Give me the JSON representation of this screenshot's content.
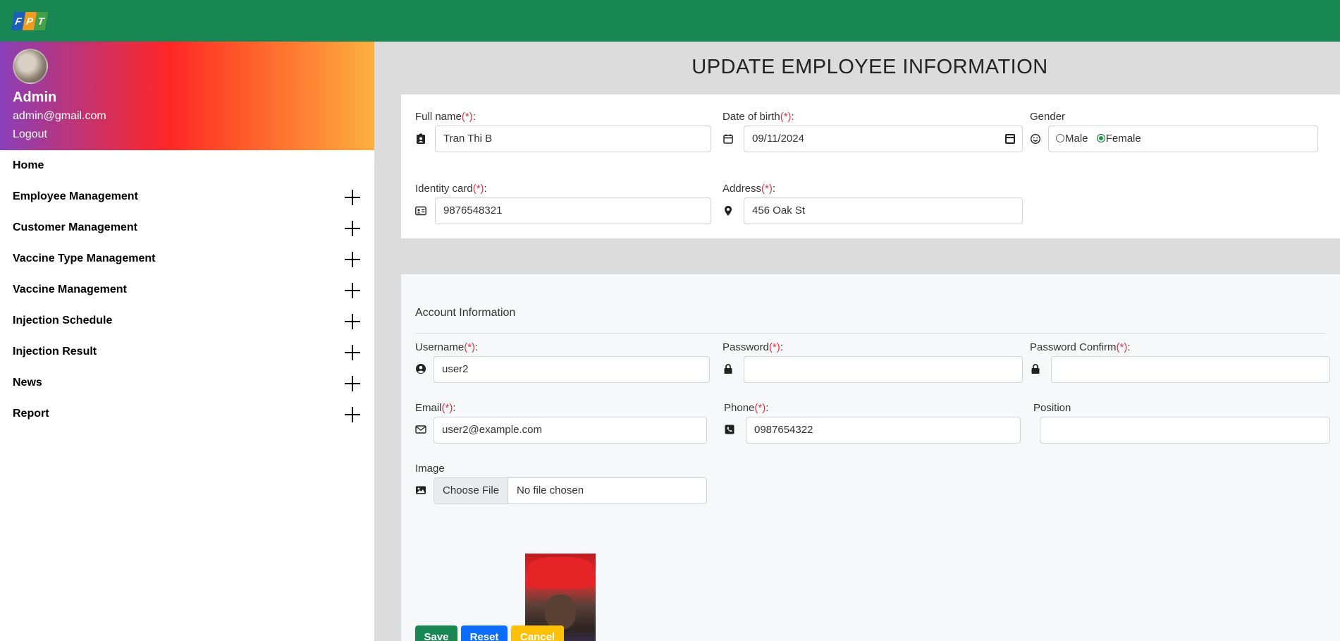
{
  "header": {
    "logo_letters": [
      "F",
      "P",
      "T"
    ],
    "logo_colors": [
      "#1c5fb8",
      "#f29a1f",
      "#43a047"
    ],
    "bar_color": "#198754"
  },
  "sidebar": {
    "user": {
      "name": "Admin",
      "email": "admin@gmail.com",
      "logout_label": "Logout"
    },
    "home_label": "Home",
    "items": [
      {
        "label": "Employee Management",
        "icon": "plus-icon"
      },
      {
        "label": "Customer Management",
        "icon": "plus-icon"
      },
      {
        "label": "Vaccine Type Management",
        "icon": "plus-icon"
      },
      {
        "label": "Vaccine Management",
        "icon": "plus-icon"
      },
      {
        "label": "Injection Schedule",
        "icon": "plus-icon"
      },
      {
        "label": "Injection Result",
        "icon": "plus-icon"
      },
      {
        "label": "News",
        "icon": "plus-icon"
      },
      {
        "label": "Report",
        "icon": "plus-icon"
      }
    ]
  },
  "main": {
    "title": "UPDATE EMPLOYEE INFORMATION",
    "required_mark": "(*)",
    "colon": ":",
    "personal": {
      "full_name": {
        "label": "Full name",
        "value": "Tran Thi B",
        "icon": "id-badge-icon"
      },
      "date_of_birth": {
        "label": "Date of birth",
        "value": "09/11/2024",
        "icon": "calendar-icon"
      },
      "gender": {
        "label": "Gender",
        "icon": "smile-icon",
        "options": [
          "Male",
          "Female"
        ],
        "selected": "Female"
      },
      "identity_card": {
        "label": "Identity card",
        "value": "9876548321",
        "icon": "id-card-icon"
      },
      "address": {
        "label": "Address",
        "value": "456 Oak St",
        "icon": "location-pin-icon"
      }
    },
    "account": {
      "section_title": "Account Information",
      "username": {
        "label": "Username",
        "value": "user2",
        "icon": "user-circle-icon"
      },
      "password": {
        "label": "Password",
        "value": "",
        "icon": "lock-icon"
      },
      "password_confirm": {
        "label": "Password Confirm",
        "value": "",
        "icon": "lock-icon"
      },
      "email": {
        "label": "Email",
        "value": "user2@example.com",
        "icon": "envelope-icon"
      },
      "phone": {
        "label": "Phone",
        "value": "0987654322",
        "icon": "phone-square-icon"
      },
      "position": {
        "label": "Position",
        "value": ""
      },
      "image": {
        "label": "Image",
        "choose_label": "Choose File",
        "file_status": "No file chosen",
        "icon": "image-icon"
      }
    },
    "buttons": {
      "save": "Save",
      "reset": "Reset",
      "cancel": "Cancel"
    },
    "colors": {
      "save": "#198754",
      "reset": "#0d6efd",
      "cancel": "#ffc107",
      "required": "#dc3545"
    }
  }
}
